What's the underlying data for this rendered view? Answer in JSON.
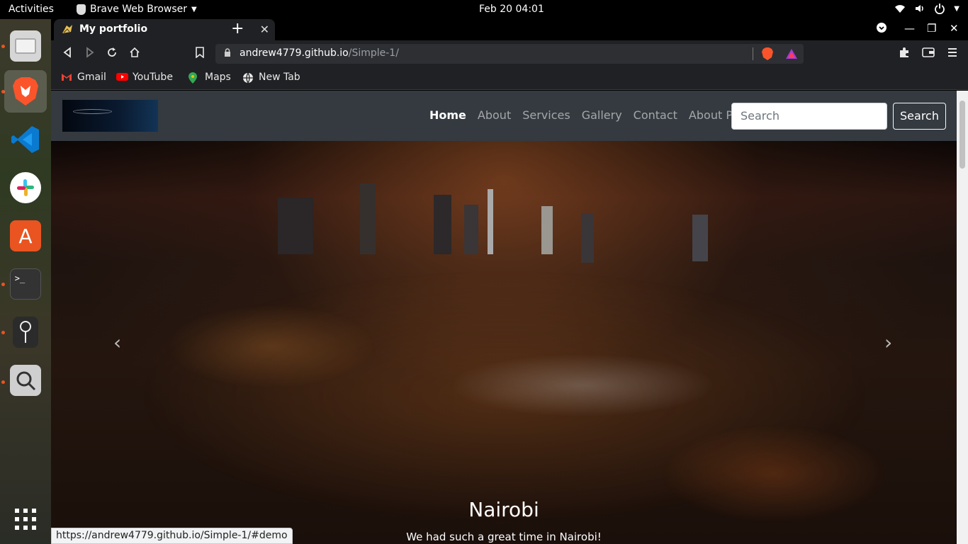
{
  "topbar": {
    "activities": "Activities",
    "app_name": "Brave Web Browser",
    "clock": "Feb 20  04:01"
  },
  "dock": {
    "items": [
      "files",
      "brave-browser",
      "vscode",
      "slack",
      "ubuntu-software",
      "terminal",
      "maps-pin",
      "screenshot",
      "show-apps"
    ]
  },
  "browser": {
    "tab_title": "My portfolio",
    "url_host": "andrew4779.github.io",
    "url_path": "/Simple-1/",
    "bookmarks": [
      "Gmail",
      "YouTube",
      "Maps",
      "New Tab"
    ],
    "status_url": "https://andrew4779.github.io/Simple-1/#demo"
  },
  "page": {
    "nav_links": [
      "Home",
      "About",
      "Services",
      "Gallery",
      "Contact",
      "About Page"
    ],
    "search_placeholder": "Search",
    "search_button": "Search",
    "caption_title": "Nairobi",
    "caption_text": "We had such a great time in Nairobi!"
  },
  "colors": {
    "navbar_bg": "#343a40",
    "accent_orange": "#e95420",
    "brave_orange": "#fb542b"
  }
}
